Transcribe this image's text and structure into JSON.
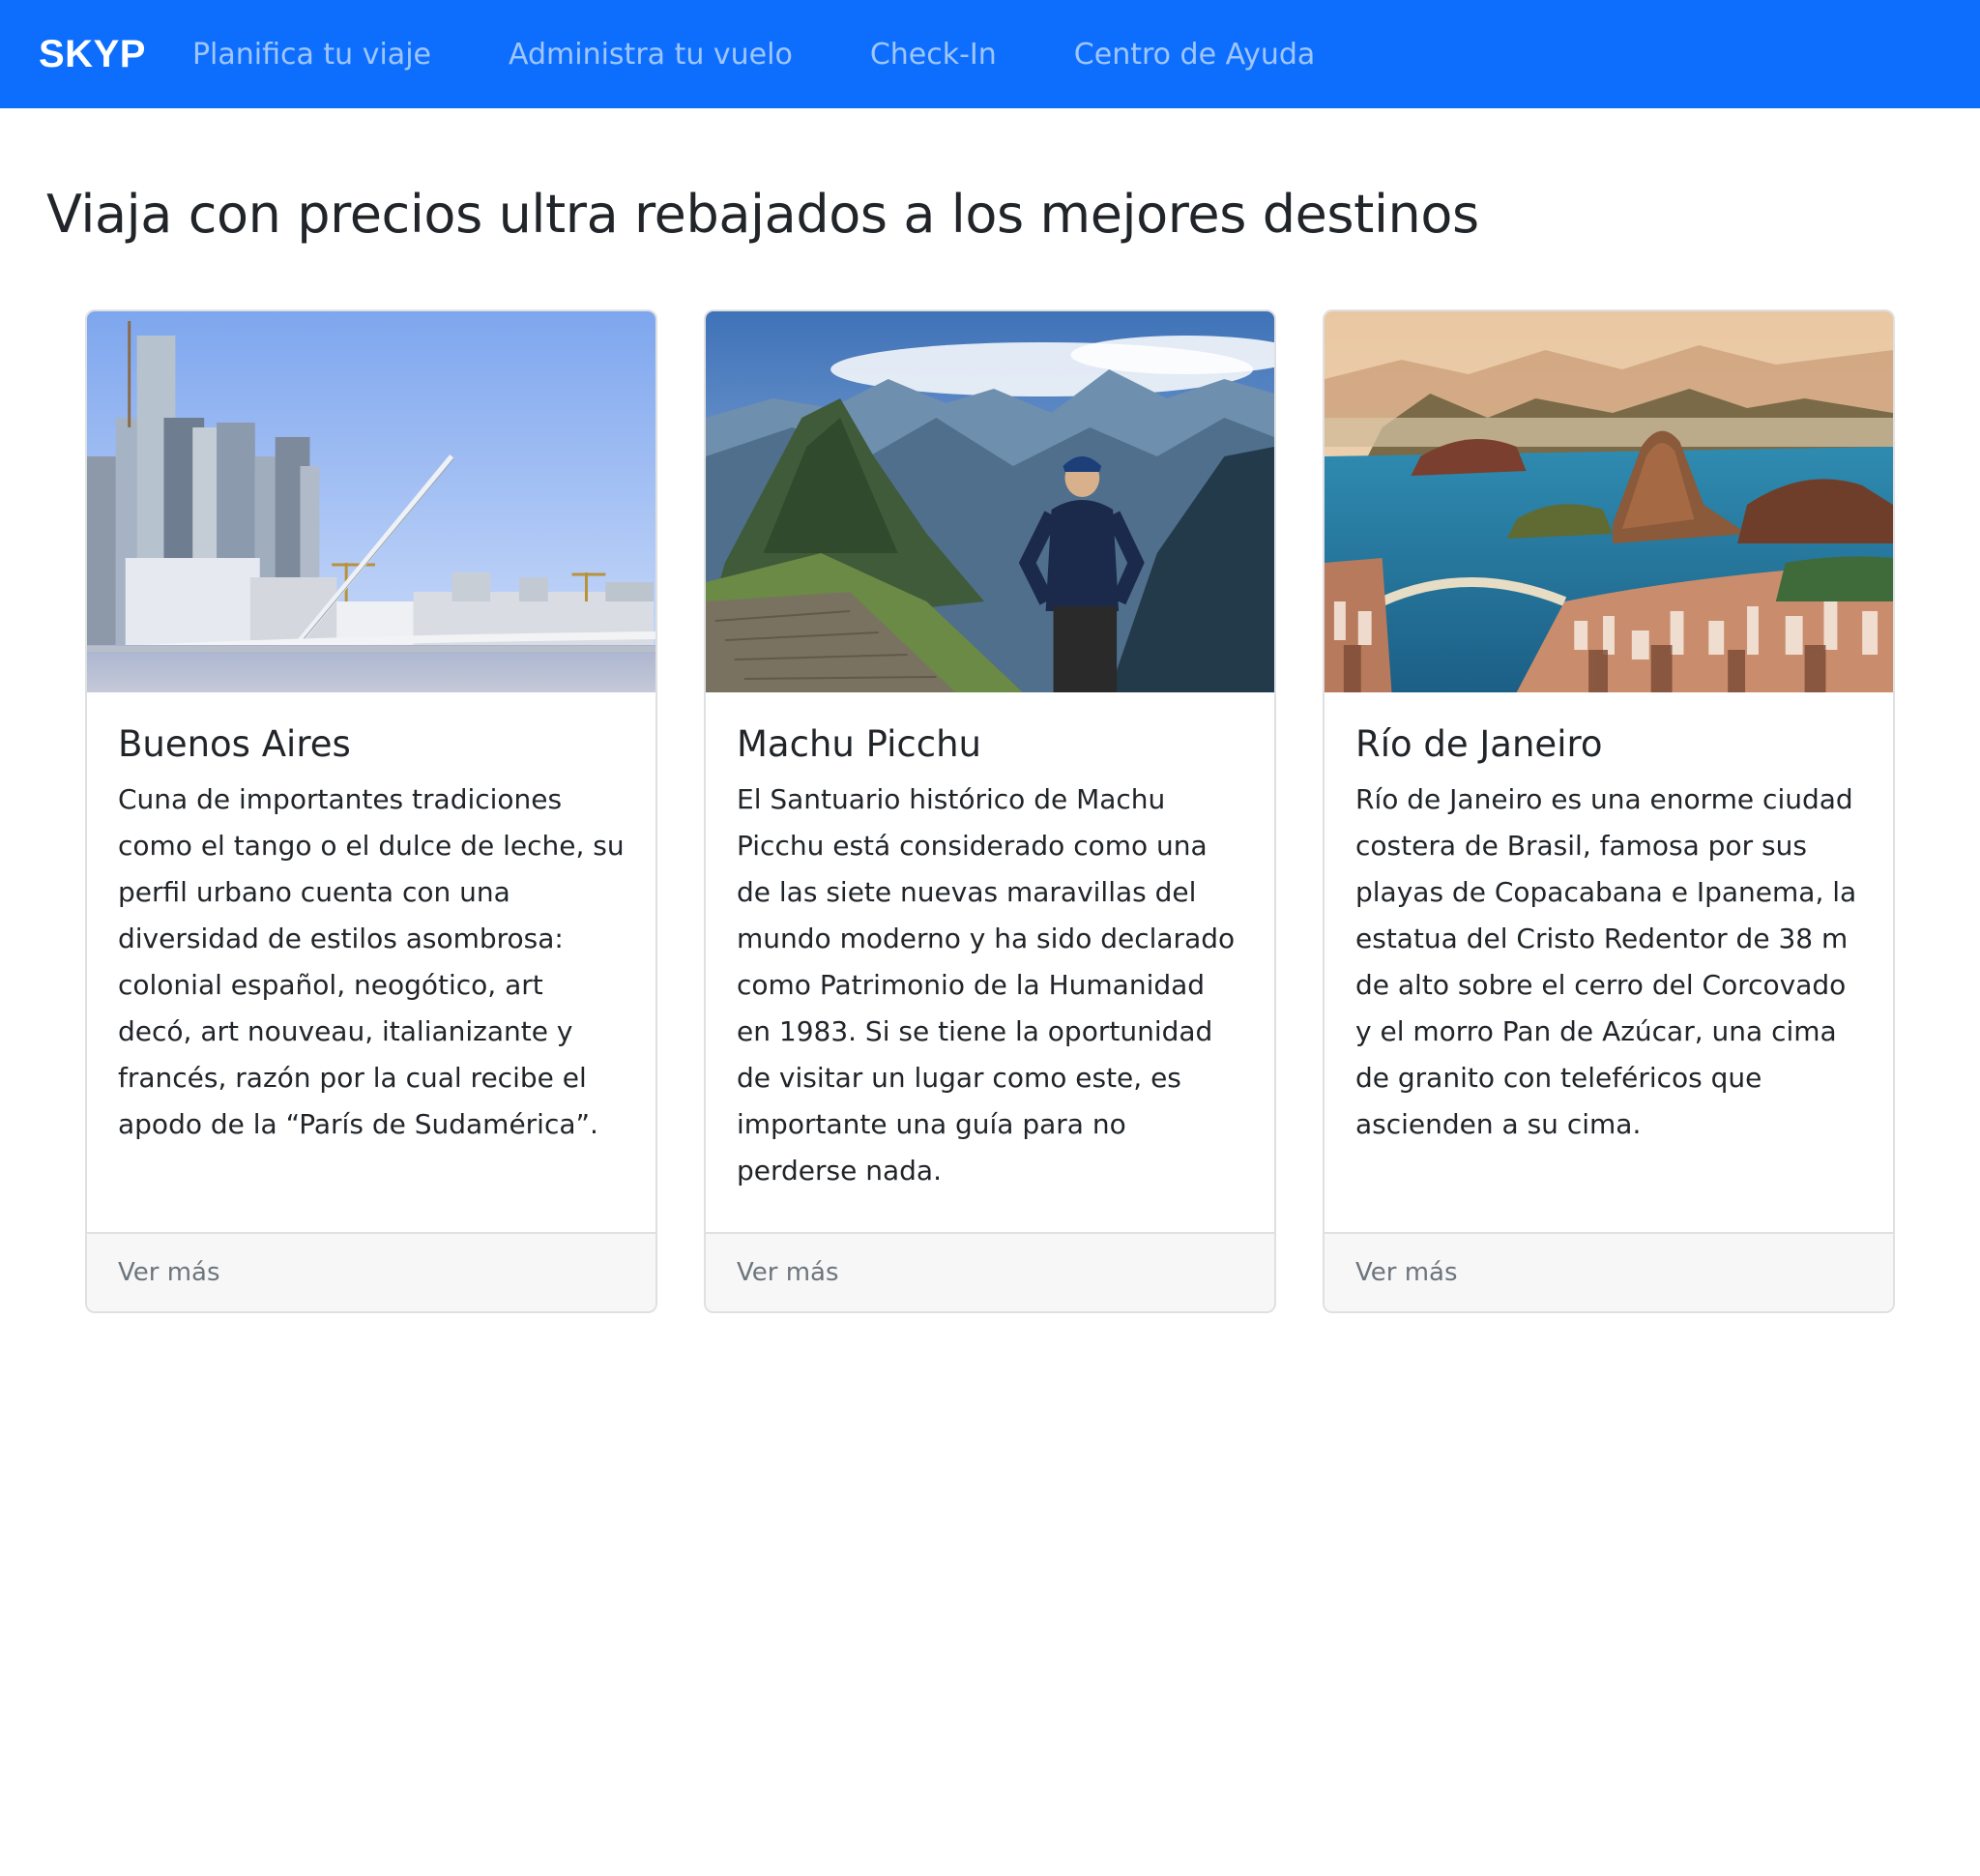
{
  "navbar": {
    "brand": "SKYP",
    "links": [
      {
        "label": "Planifica tu viaje"
      },
      {
        "label": "Administra tu vuelo"
      },
      {
        "label": "Check-In"
      },
      {
        "label": "Centro de Ayuda"
      }
    ]
  },
  "main": {
    "title": "Viaja con precios ultra rebajados a los mejores destinos",
    "cards": [
      {
        "title": "Buenos Aires",
        "text": "Cuna de importantes tradiciones como el tango o el dulce de leche, su perfil urbano cuenta con una diversidad de estilos asombrosa: colonial español, neogótico, art decó, art nouveau, italianizante y francés, razón por la cual recibe el apodo de la “París de Sudamérica”.",
        "link": "Ver más"
      },
      {
        "title": "Machu Picchu",
        "text": "El Santuario histórico de Machu Picchu está considerado como una de las siete nuevas maravillas del mundo moderno y ha sido declarado como Patrimonio de la Humanidad en 1983. Si se tiene la oportunidad de visitar un lugar como este, es importante una guía para no perderse nada.",
        "link": "Ver más"
      },
      {
        "title": "Río de Janeiro",
        "text": "Río de Janeiro es una enorme ciudad costera de Brasil, famosa por sus playas de Copacabana e Ipanema, la estatua del Cristo Redentor de 38 m de alto sobre el cerro del Corcovado y el morro Pan de Azúcar, una cima de granito con teleféricos que ascienden a su cima.",
        "link": "Ver más"
      }
    ]
  },
  "colors": {
    "navbar_bg": "#0d6efd",
    "nav_link": "rgba(255,255,255,0.6)",
    "footer_bg": "#f7f7f7",
    "link_gray": "#6c757d"
  }
}
